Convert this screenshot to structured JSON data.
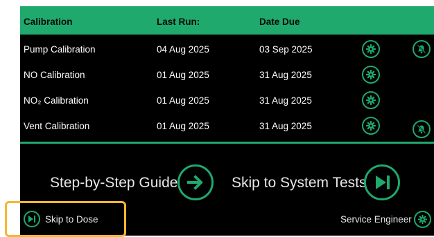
{
  "table": {
    "headers": {
      "name": "Calibration",
      "last_run": "Last Run:",
      "date_due": "Date Due"
    },
    "rows": [
      {
        "name": "Pump Calibration",
        "last_run": "04 Aug 2025",
        "date_due": "03 Sep 2025",
        "alert": "bell-off-icon"
      },
      {
        "name": "NO Calibration",
        "last_run": "01 Aug 2025",
        "date_due": "31 Aug 2025",
        "alert": ""
      },
      {
        "name": "NO₂ Calibration",
        "last_run": "01 Aug 2025",
        "date_due": "31 Aug 2025",
        "alert": ""
      },
      {
        "name": "Vent Calibration",
        "last_run": "01 Aug 2025",
        "date_due": "31 Aug 2025",
        "alert": "bell-off-icon"
      }
    ]
  },
  "actions": {
    "guide_label": "Step-by-Step Guide",
    "skip_tests_label": "Skip to System Tests",
    "skip_dose_label": "Skip to Dose",
    "service_label": "Service Engineer"
  },
  "colors": {
    "accent": "#1fa96d",
    "background": "#000000",
    "highlight": "#f5b731"
  }
}
